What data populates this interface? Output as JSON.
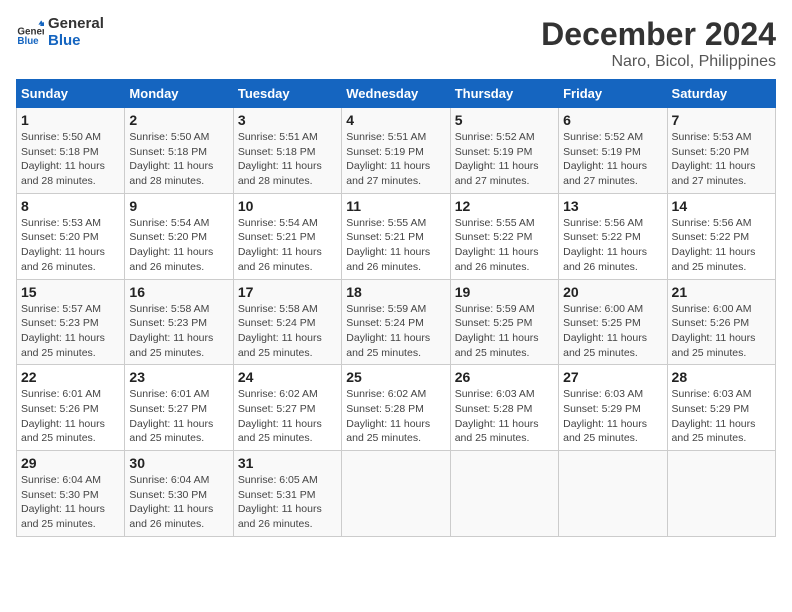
{
  "logo": {
    "line1": "General",
    "line2": "Blue"
  },
  "title": "December 2024",
  "subtitle": "Naro, Bicol, Philippines",
  "days_header": [
    "Sunday",
    "Monday",
    "Tuesday",
    "Wednesday",
    "Thursday",
    "Friday",
    "Saturday"
  ],
  "weeks": [
    [
      {
        "day": "1",
        "sunrise": "Sunrise: 5:50 AM",
        "sunset": "Sunset: 5:18 PM",
        "daylight": "Daylight: 11 hours and 28 minutes."
      },
      {
        "day": "2",
        "sunrise": "Sunrise: 5:50 AM",
        "sunset": "Sunset: 5:18 PM",
        "daylight": "Daylight: 11 hours and 28 minutes."
      },
      {
        "day": "3",
        "sunrise": "Sunrise: 5:51 AM",
        "sunset": "Sunset: 5:18 PM",
        "daylight": "Daylight: 11 hours and 28 minutes."
      },
      {
        "day": "4",
        "sunrise": "Sunrise: 5:51 AM",
        "sunset": "Sunset: 5:19 PM",
        "daylight": "Daylight: 11 hours and 27 minutes."
      },
      {
        "day": "5",
        "sunrise": "Sunrise: 5:52 AM",
        "sunset": "Sunset: 5:19 PM",
        "daylight": "Daylight: 11 hours and 27 minutes."
      },
      {
        "day": "6",
        "sunrise": "Sunrise: 5:52 AM",
        "sunset": "Sunset: 5:19 PM",
        "daylight": "Daylight: 11 hours and 27 minutes."
      },
      {
        "day": "7",
        "sunrise": "Sunrise: 5:53 AM",
        "sunset": "Sunset: 5:20 PM",
        "daylight": "Daylight: 11 hours and 27 minutes."
      }
    ],
    [
      {
        "day": "8",
        "sunrise": "Sunrise: 5:53 AM",
        "sunset": "Sunset: 5:20 PM",
        "daylight": "Daylight: 11 hours and 26 minutes."
      },
      {
        "day": "9",
        "sunrise": "Sunrise: 5:54 AM",
        "sunset": "Sunset: 5:20 PM",
        "daylight": "Daylight: 11 hours and 26 minutes."
      },
      {
        "day": "10",
        "sunrise": "Sunrise: 5:54 AM",
        "sunset": "Sunset: 5:21 PM",
        "daylight": "Daylight: 11 hours and 26 minutes."
      },
      {
        "day": "11",
        "sunrise": "Sunrise: 5:55 AM",
        "sunset": "Sunset: 5:21 PM",
        "daylight": "Daylight: 11 hours and 26 minutes."
      },
      {
        "day": "12",
        "sunrise": "Sunrise: 5:55 AM",
        "sunset": "Sunset: 5:22 PM",
        "daylight": "Daylight: 11 hours and 26 minutes."
      },
      {
        "day": "13",
        "sunrise": "Sunrise: 5:56 AM",
        "sunset": "Sunset: 5:22 PM",
        "daylight": "Daylight: 11 hours and 26 minutes."
      },
      {
        "day": "14",
        "sunrise": "Sunrise: 5:56 AM",
        "sunset": "Sunset: 5:22 PM",
        "daylight": "Daylight: 11 hours and 25 minutes."
      }
    ],
    [
      {
        "day": "15",
        "sunrise": "Sunrise: 5:57 AM",
        "sunset": "Sunset: 5:23 PM",
        "daylight": "Daylight: 11 hours and 25 minutes."
      },
      {
        "day": "16",
        "sunrise": "Sunrise: 5:58 AM",
        "sunset": "Sunset: 5:23 PM",
        "daylight": "Daylight: 11 hours and 25 minutes."
      },
      {
        "day": "17",
        "sunrise": "Sunrise: 5:58 AM",
        "sunset": "Sunset: 5:24 PM",
        "daylight": "Daylight: 11 hours and 25 minutes."
      },
      {
        "day": "18",
        "sunrise": "Sunrise: 5:59 AM",
        "sunset": "Sunset: 5:24 PM",
        "daylight": "Daylight: 11 hours and 25 minutes."
      },
      {
        "day": "19",
        "sunrise": "Sunrise: 5:59 AM",
        "sunset": "Sunset: 5:25 PM",
        "daylight": "Daylight: 11 hours and 25 minutes."
      },
      {
        "day": "20",
        "sunrise": "Sunrise: 6:00 AM",
        "sunset": "Sunset: 5:25 PM",
        "daylight": "Daylight: 11 hours and 25 minutes."
      },
      {
        "day": "21",
        "sunrise": "Sunrise: 6:00 AM",
        "sunset": "Sunset: 5:26 PM",
        "daylight": "Daylight: 11 hours and 25 minutes."
      }
    ],
    [
      {
        "day": "22",
        "sunrise": "Sunrise: 6:01 AM",
        "sunset": "Sunset: 5:26 PM",
        "daylight": "Daylight: 11 hours and 25 minutes."
      },
      {
        "day": "23",
        "sunrise": "Sunrise: 6:01 AM",
        "sunset": "Sunset: 5:27 PM",
        "daylight": "Daylight: 11 hours and 25 minutes."
      },
      {
        "day": "24",
        "sunrise": "Sunrise: 6:02 AM",
        "sunset": "Sunset: 5:27 PM",
        "daylight": "Daylight: 11 hours and 25 minutes."
      },
      {
        "day": "25",
        "sunrise": "Sunrise: 6:02 AM",
        "sunset": "Sunset: 5:28 PM",
        "daylight": "Daylight: 11 hours and 25 minutes."
      },
      {
        "day": "26",
        "sunrise": "Sunrise: 6:03 AM",
        "sunset": "Sunset: 5:28 PM",
        "daylight": "Daylight: 11 hours and 25 minutes."
      },
      {
        "day": "27",
        "sunrise": "Sunrise: 6:03 AM",
        "sunset": "Sunset: 5:29 PM",
        "daylight": "Daylight: 11 hours and 25 minutes."
      },
      {
        "day": "28",
        "sunrise": "Sunrise: 6:03 AM",
        "sunset": "Sunset: 5:29 PM",
        "daylight": "Daylight: 11 hours and 25 minutes."
      }
    ],
    [
      {
        "day": "29",
        "sunrise": "Sunrise: 6:04 AM",
        "sunset": "Sunset: 5:30 PM",
        "daylight": "Daylight: 11 hours and 25 minutes."
      },
      {
        "day": "30",
        "sunrise": "Sunrise: 6:04 AM",
        "sunset": "Sunset: 5:30 PM",
        "daylight": "Daylight: 11 hours and 26 minutes."
      },
      {
        "day": "31",
        "sunrise": "Sunrise: 6:05 AM",
        "sunset": "Sunset: 5:31 PM",
        "daylight": "Daylight: 11 hours and 26 minutes."
      },
      null,
      null,
      null,
      null
    ]
  ]
}
